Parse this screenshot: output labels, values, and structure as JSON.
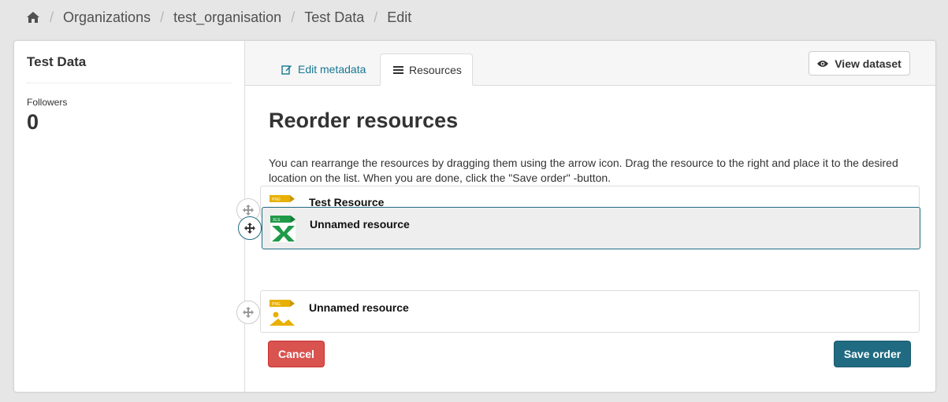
{
  "breadcrumb": {
    "items": [
      "Organizations",
      "test_organisation",
      "Test Data",
      "Edit"
    ]
  },
  "sidebar": {
    "title": "Test Data",
    "followers_label": "Followers",
    "followers_count": "0"
  },
  "tabs": {
    "edit_metadata": "Edit metadata",
    "resources": "Resources"
  },
  "view_dataset_label": "View dataset",
  "page_title": "Reorder resources",
  "help_text": "You can rearrange the resources by dragging them using the arrow icon. Drag the resource to the right and place it to the desired location on the list. When you are done, click the \"Save order\" -button.",
  "resources": [
    {
      "name": "Test Resource",
      "format": "PNG"
    },
    {
      "name": "Unnamed resource",
      "format": "XLS"
    },
    {
      "name": "Unnamed resource",
      "format": "PNG"
    }
  ],
  "cancel_label": "Cancel",
  "save_label": "Save order",
  "colors": {
    "link": "#187794",
    "danger": "#d9534f",
    "primary": "#206b82",
    "png": "#e8b000",
    "xls": "#1f9a48"
  }
}
